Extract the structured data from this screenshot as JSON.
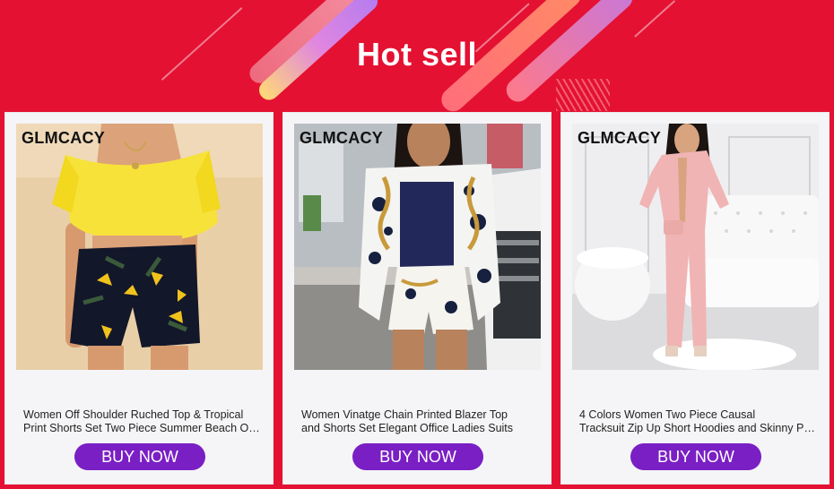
{
  "header": {
    "title": "Hot sell"
  },
  "products": [
    {
      "brand": "GLMCACY",
      "line1": "Women Off Shoulder Ruched Top & Tropical",
      "line2": "Print Shorts Set Two Piece Summer Beach Outfit",
      "button": "BUY NOW"
    },
    {
      "brand": "GLMCACY",
      "line1": "Women Vinatge Chain Printed Blazer Top",
      "line2": "and Shorts Set Elegant Office Ladies Suits",
      "button": "BUY NOW"
    },
    {
      "brand": "GLMCACY",
      "line1": "4 Colors Women Two Piece Causal",
      "line2": "Tracksuit Zip Up Short Hoodies and Skinny Pants",
      "button": "BUY NOW"
    }
  ],
  "colors": {
    "background": "#e41132",
    "button": "#7a1fc4",
    "card": "#f5f5f7"
  }
}
